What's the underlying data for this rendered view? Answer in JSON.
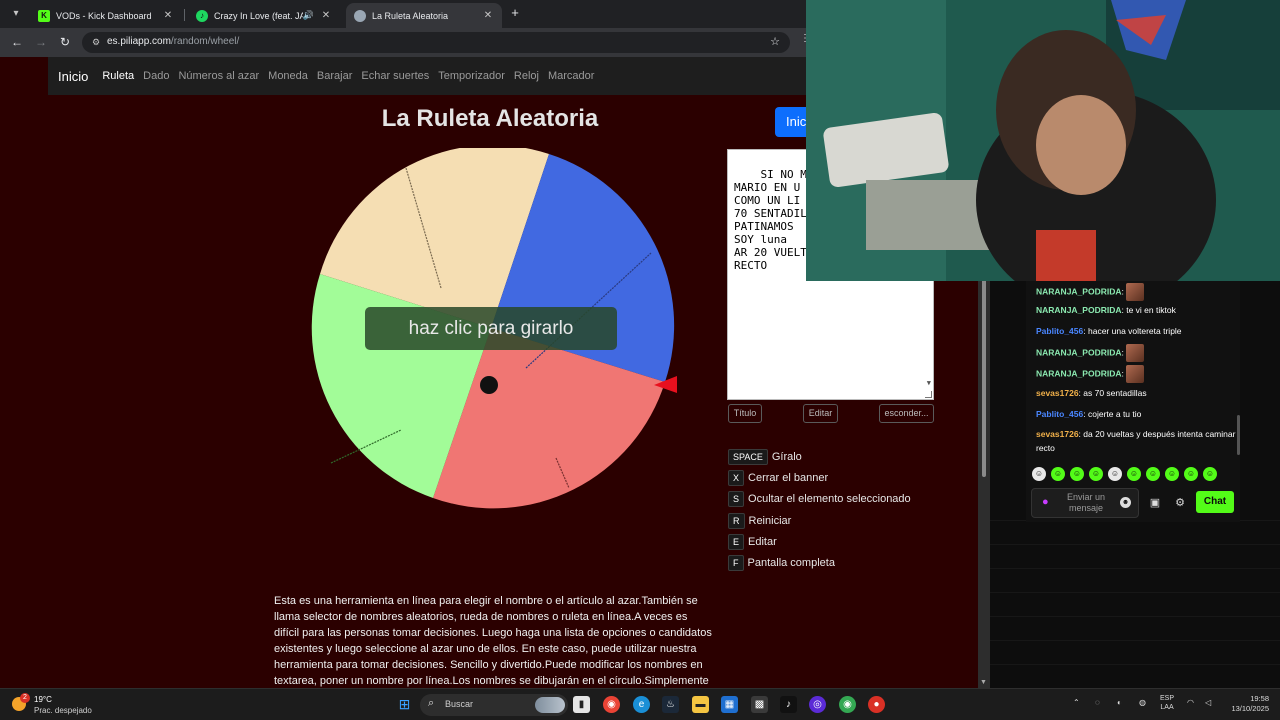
{
  "browser": {
    "tabs": [
      {
        "title": "VODs - Kick Dashboard",
        "favicon": "kick-icon",
        "active": false
      },
      {
        "title": "Crazy In Love (feat. JAY-Z) -",
        "favicon": "spotify-icon",
        "active": false,
        "muted_icon": "speaker-icon"
      },
      {
        "title": "La Ruleta Aleatoria",
        "favicon": "piliapp-icon",
        "active": true
      }
    ],
    "url_domain": "es.piliapp.com",
    "url_path": "/random/wheel/"
  },
  "site": {
    "brand": "Inicio",
    "nav": [
      "Ruleta",
      "Dado",
      "Números al azar",
      "Moneda",
      "Barajar",
      "Echar suertes",
      "Temporizador",
      "Reloj",
      "Marcador"
    ],
    "nav_active": "Ruleta",
    "start_button": "Inicio",
    "title": "La Ruleta Aleatoria"
  },
  "wheel": {
    "spin_label": "haz clic para girarlo",
    "colors": {
      "beige": "#f5deb3",
      "blue": "#4169e1",
      "red": "#f07673",
      "green": "#a2fc98",
      "pointer": "#e8101e"
    }
  },
  "editor": {
    "textarea_value": "SI NO ME PA\nMARIO EN U\nCOMO UN LI\n70 SENTADIL\nPATINAMOS\nSOY luna\nAR 20 VUELTA\nRECTO",
    "buttons": {
      "title": "Título",
      "edit": "Editar",
      "hide": "esconder..."
    }
  },
  "shortcuts": [
    {
      "key": "SPACE",
      "desc": "Gíralo"
    },
    {
      "key": "X",
      "desc": "Cerrar el banner"
    },
    {
      "key": "S",
      "desc": "Ocultar el elemento seleccionado"
    },
    {
      "key": "R",
      "desc": "Reiniciar"
    },
    {
      "key": "E",
      "desc": "Editar"
    },
    {
      "key": "F",
      "desc": "Pantalla completa"
    }
  ],
  "description": "Esta es una herramienta en línea para elegir el nombre o el artículo al azar.También se llama selector de nombres aleatorios, rueda de nombres o ruleta en línea.A veces es difícil para las personas tomar decisiones. Luego haga una lista de opciones o candidatos existentes y luego seleccione al azar uno de ellos. En este caso, puede utilizar nuestra herramienta para tomar decisiones. Sencillo y divertido.Puede modificar los nombres en textarea, poner un nombre por línea.Los nombres se dibujarán en el círculo.Simplemente haga clic en la rueda",
  "chat": {
    "messages": [
      {
        "user": "NARANJA_PODRIDA",
        "color": "#8be9b0",
        "text": "",
        "emote": true
      },
      {
        "user": "NARANJA_PODRIDA",
        "color": "#8be9b0",
        "text": "te vi en tiktok",
        "emote": false
      },
      {
        "user": "Pablito_456",
        "color": "#4a86ff",
        "text": "hacer una voltereta triple",
        "emote": false
      },
      {
        "user": "NARANJA_PODRIDA",
        "color": "#8be9b0",
        "text": "",
        "emote": true
      },
      {
        "user": "NARANJA_PODRIDA",
        "color": "#8be9b0",
        "text": "",
        "emote": true
      },
      {
        "user": "sevas1726",
        "color": "#f2b14a",
        "text": "as 70 sentadillas",
        "emote": false
      },
      {
        "user": "Pablito_456",
        "color": "#4a86ff",
        "text": "cojerte a tu tio",
        "emote": false
      },
      {
        "user": "sevas1726",
        "color": "#f2b14a",
        "text": "da 20 vueltas y después intenta caminar recto",
        "emote": false
      }
    ],
    "input_placeholder": "Enviar un mensaje",
    "send_label": "Chat",
    "accent": "#53fc18"
  },
  "taskbar": {
    "weather_temp": "19°C",
    "weather_cond": "Prac. despejado",
    "weather_badge": "2",
    "search_label": "Buscar",
    "lang_top": "ESP",
    "lang_bottom": "LAA",
    "time": "19:58",
    "date": "13/10/2025"
  }
}
